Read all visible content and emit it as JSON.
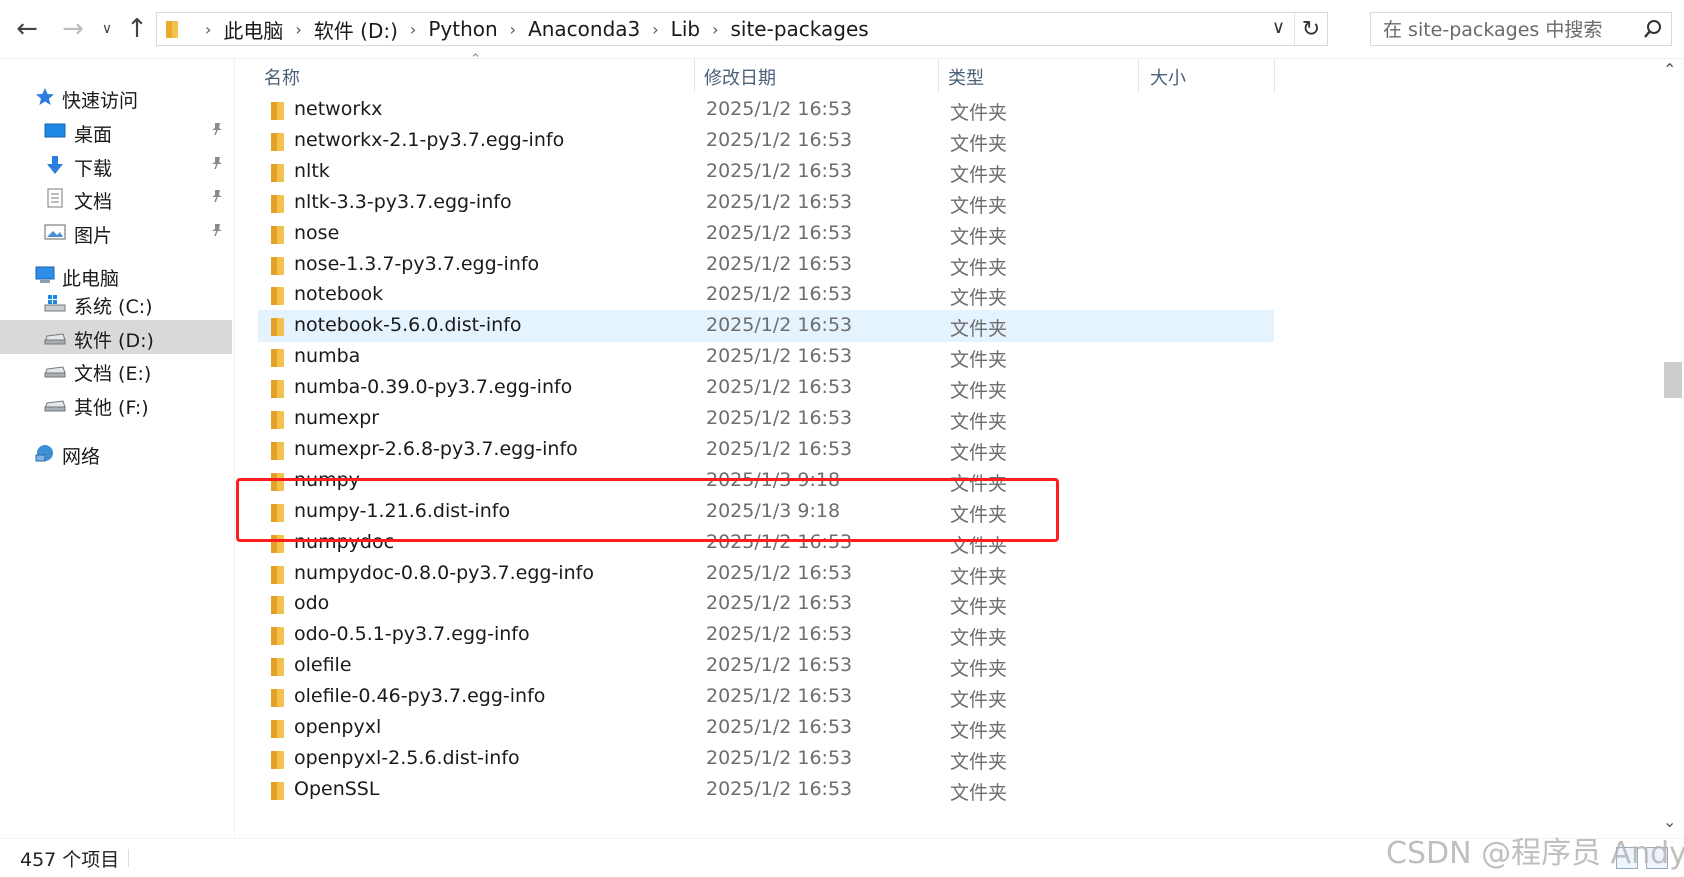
{
  "addressbar": {
    "breadcrumbs": [
      "此电脑",
      "软件 (D:)",
      "Python",
      "Anaconda3",
      "Lib",
      "site-packages"
    ],
    "search_placeholder": "在 site-packages 中搜索"
  },
  "sidebar": {
    "quick_access": "快速访问",
    "pinned": [
      {
        "label": "桌面",
        "icon": "desktop-icon"
      },
      {
        "label": "下载",
        "icon": "download-icon"
      },
      {
        "label": "文档",
        "icon": "document-icon"
      },
      {
        "label": "图片",
        "icon": "picture-icon"
      }
    ],
    "this_pc": "此电脑",
    "drives": [
      {
        "label": "系统 (C:)",
        "icon": "system-drive-icon"
      },
      {
        "label": "软件 (D:)",
        "icon": "drive-icon",
        "selected": true
      },
      {
        "label": "文档 (E:)",
        "icon": "drive-icon"
      },
      {
        "label": "其他 (F:)",
        "icon": "drive-icon"
      }
    ],
    "network": "网络"
  },
  "columns": {
    "name": "名称",
    "date": "修改日期",
    "type": "类型",
    "size": "大小"
  },
  "files": [
    {
      "name": "networkx",
      "date": "2025/1/2 16:53",
      "type": "文件夹"
    },
    {
      "name": "networkx-2.1-py3.7.egg-info",
      "date": "2025/1/2 16:53",
      "type": "文件夹"
    },
    {
      "name": "nltk",
      "date": "2025/1/2 16:53",
      "type": "文件夹"
    },
    {
      "name": "nltk-3.3-py3.7.egg-info",
      "date": "2025/1/2 16:53",
      "type": "文件夹"
    },
    {
      "name": "nose",
      "date": "2025/1/2 16:53",
      "type": "文件夹"
    },
    {
      "name": "nose-1.3.7-py3.7.egg-info",
      "date": "2025/1/2 16:53",
      "type": "文件夹"
    },
    {
      "name": "notebook",
      "date": "2025/1/2 16:53",
      "type": "文件夹"
    },
    {
      "name": "notebook-5.6.0.dist-info",
      "date": "2025/1/2 16:53",
      "type": "文件夹",
      "hover": true
    },
    {
      "name": "numba",
      "date": "2025/1/2 16:53",
      "type": "文件夹"
    },
    {
      "name": "numba-0.39.0-py3.7.egg-info",
      "date": "2025/1/2 16:53",
      "type": "文件夹"
    },
    {
      "name": "numexpr",
      "date": "2025/1/2 16:53",
      "type": "文件夹"
    },
    {
      "name": "numexpr-2.6.8-py3.7.egg-info",
      "date": "2025/1/2 16:53",
      "type": "文件夹"
    },
    {
      "name": "numpy",
      "date": "2025/1/3 9:18",
      "type": "文件夹"
    },
    {
      "name": "numpy-1.21.6.dist-info",
      "date": "2025/1/3 9:18",
      "type": "文件夹"
    },
    {
      "name": "numpydoc",
      "date": "2025/1/2 16:53",
      "type": "文件夹"
    },
    {
      "name": "numpydoc-0.8.0-py3.7.egg-info",
      "date": "2025/1/2 16:53",
      "type": "文件夹"
    },
    {
      "name": "odo",
      "date": "2025/1/2 16:53",
      "type": "文件夹"
    },
    {
      "name": "odo-0.5.1-py3.7.egg-info",
      "date": "2025/1/2 16:53",
      "type": "文件夹"
    },
    {
      "name": "olefile",
      "date": "2025/1/2 16:53",
      "type": "文件夹"
    },
    {
      "name": "olefile-0.46-py3.7.egg-info",
      "date": "2025/1/2 16:53",
      "type": "文件夹"
    },
    {
      "name": "openpyxl",
      "date": "2025/1/2 16:53",
      "type": "文件夹"
    },
    {
      "name": "openpyxl-2.5.6.dist-info",
      "date": "2025/1/2 16:53",
      "type": "文件夹"
    },
    {
      "name": "OpenSSL",
      "date": "2025/1/2 16:53",
      "type": "文件夹"
    }
  ],
  "status": {
    "item_count": "457 个项目"
  },
  "watermark": "CSDN @程序员 Andy",
  "colors": {
    "folder": "#f2c14e",
    "highlight_border": "#ff1e1e",
    "hover_row": "#e5f3ff",
    "selected_nav": "#d9d9d9"
  }
}
